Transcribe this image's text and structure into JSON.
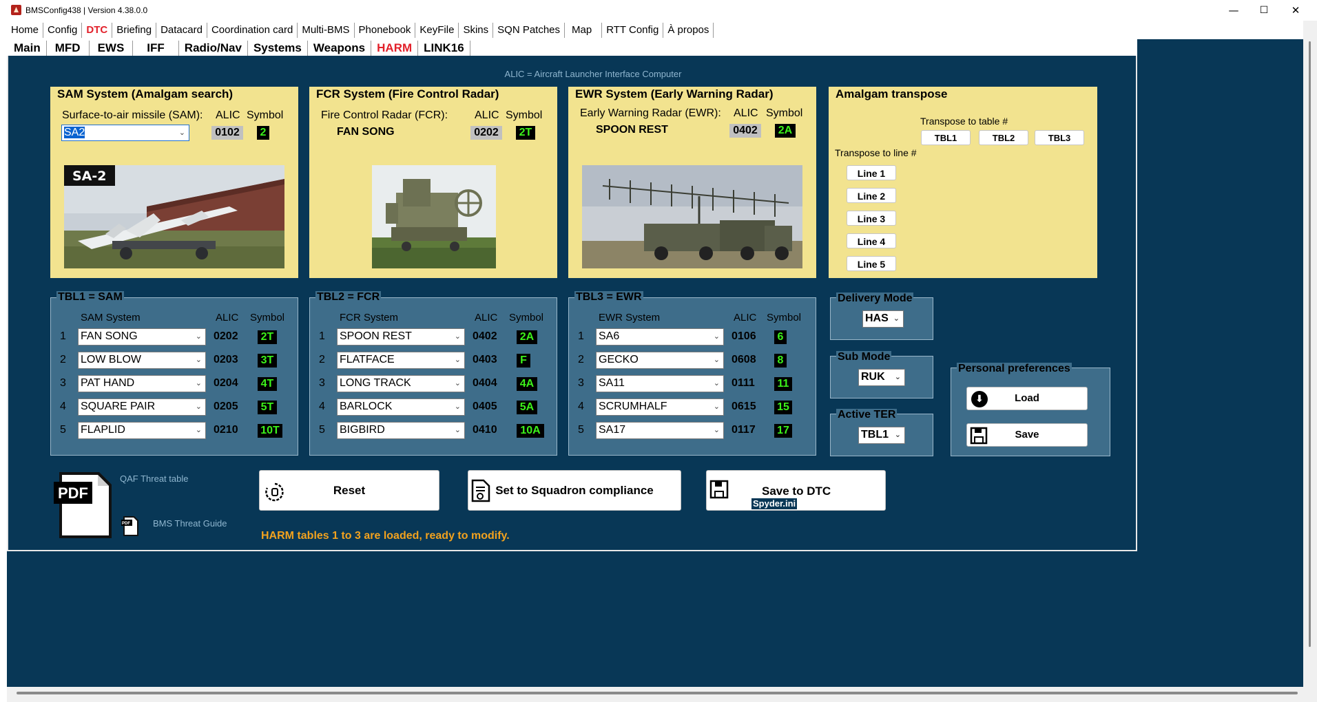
{
  "window": {
    "title": "BMSConfig438 | Version 4.38.0.0",
    "controls": {
      "minimize": "—",
      "maximize": "☐",
      "close": "✕"
    }
  },
  "menu": [
    "Home",
    "Config",
    "DTC",
    "Briefing",
    "Datacard",
    "Coordination card",
    "Multi-BMS",
    "Phonebook",
    "KeyFile",
    "Skins",
    "SQN Patches",
    "Map",
    "RTT Config",
    "À propos"
  ],
  "menu_active": "DTC",
  "subtabs": [
    "Main",
    "MFD",
    "EWS",
    "IFF",
    "Radio/Nav",
    "Systems",
    "Weapons",
    "HARM",
    "LINK16"
  ],
  "subtab_active": "HARM",
  "caption": "ALIC = Aircraft Launcher Interface Computer",
  "sam_panel": {
    "title": "SAM System (Amalgam search)",
    "label": "Surface-to-air missile (SAM):",
    "alic_header": "ALIC",
    "symbol_header": "Symbol",
    "selected": "SA2",
    "alic": "0102",
    "symbol": "2",
    "photo_label": "SA-2"
  },
  "fcr_panel": {
    "title": "FCR System (Fire Control Radar)",
    "label": "Fire Control Radar (FCR):",
    "alic_header": "ALIC",
    "symbol_header": "Symbol",
    "value": "FAN SONG",
    "alic": "0202",
    "symbol": "2T"
  },
  "ewr_panel": {
    "title": "EWR System (Early Warning Radar)",
    "label": "Early Warning Radar (EWR):",
    "alic_header": "ALIC",
    "symbol_header": "Symbol",
    "value": "SPOON REST",
    "alic": "0402",
    "symbol": "2A"
  },
  "transpose": {
    "title": "Amalgam transpose",
    "table_label": "Transpose to table #",
    "tables": [
      "TBL1",
      "TBL2",
      "TBL3"
    ],
    "line_label": "Transpose to line #",
    "lines": [
      "Line 1",
      "Line 2",
      "Line 3",
      "Line 4",
      "Line 5"
    ]
  },
  "tables": [
    {
      "title": "TBL1 = SAM",
      "col_system": "SAM System",
      "col_alic": "ALIC",
      "col_symbol": "Symbol",
      "rows": [
        {
          "n": "1",
          "system": "FAN SONG",
          "alic": "0202",
          "symbol": "2T"
        },
        {
          "n": "2",
          "system": "LOW BLOW",
          "alic": "0203",
          "symbol": "3T"
        },
        {
          "n": "3",
          "system": "PAT HAND",
          "alic": "0204",
          "symbol": "4T"
        },
        {
          "n": "4",
          "system": "SQUARE PAIR",
          "alic": "0205",
          "symbol": "5T"
        },
        {
          "n": "5",
          "system": "FLAPLID",
          "alic": "0210",
          "symbol": "10T"
        }
      ]
    },
    {
      "title": "TBL2 = FCR",
      "col_system": "FCR System",
      "col_alic": "ALIC",
      "col_symbol": "Symbol",
      "rows": [
        {
          "n": "1",
          "system": "SPOON REST",
          "alic": "0402",
          "symbol": "2A"
        },
        {
          "n": "2",
          "system": "FLATFACE",
          "alic": "0403",
          "symbol": "F"
        },
        {
          "n": "3",
          "system": "LONG TRACK",
          "alic": "0404",
          "symbol": "4A"
        },
        {
          "n": "4",
          "system": "BARLOCK",
          "alic": "0405",
          "symbol": "5A"
        },
        {
          "n": "5",
          "system": "BIGBIRD",
          "alic": "0410",
          "symbol": "10A"
        }
      ]
    },
    {
      "title": "TBL3 = EWR",
      "col_system": "EWR System",
      "col_alic": "ALIC",
      "col_symbol": "Symbol",
      "rows": [
        {
          "n": "1",
          "system": "SA6",
          "alic": "0106",
          "symbol": "6"
        },
        {
          "n": "2",
          "system": "GECKO",
          "alic": "0608",
          "symbol": "8"
        },
        {
          "n": "3",
          "system": "SA11",
          "alic": "0111",
          "symbol": "11"
        },
        {
          "n": "4",
          "system": "SCRUMHALF",
          "alic": "0615",
          "symbol": "15"
        },
        {
          "n": "5",
          "system": "SA17",
          "alic": "0117",
          "symbol": "17"
        }
      ]
    }
  ],
  "delivery_mode": {
    "title": "Delivery Mode",
    "value": "HAS"
  },
  "sub_mode": {
    "title": "Sub Mode",
    "value": "RUK"
  },
  "active_ter": {
    "title": "Active TER",
    "value": "TBL1"
  },
  "prefs": {
    "title": "Personal preferences",
    "load": "Load",
    "save": "Save"
  },
  "actions": {
    "reset": "Reset",
    "squadron": "Set to Squadron compliance",
    "save_dtc": "Save to DTC",
    "save_dtc_file": "Spyder.ini"
  },
  "docs": {
    "pdf_label": "PDF",
    "pdf_small_label": "PDF",
    "qaf": "QAF Threat table",
    "bms": "BMS Threat Guide"
  },
  "status": "HARM tables 1 to 3 are loaded, ready to modify.",
  "colors": {
    "background": "#083756",
    "panel_yellow": "#f2e38f",
    "group_blue": "#3e6d8a",
    "symbol_green": "#3cf21a",
    "active_tab_red": "#e2202a",
    "status_orange": "#f2a21e"
  }
}
